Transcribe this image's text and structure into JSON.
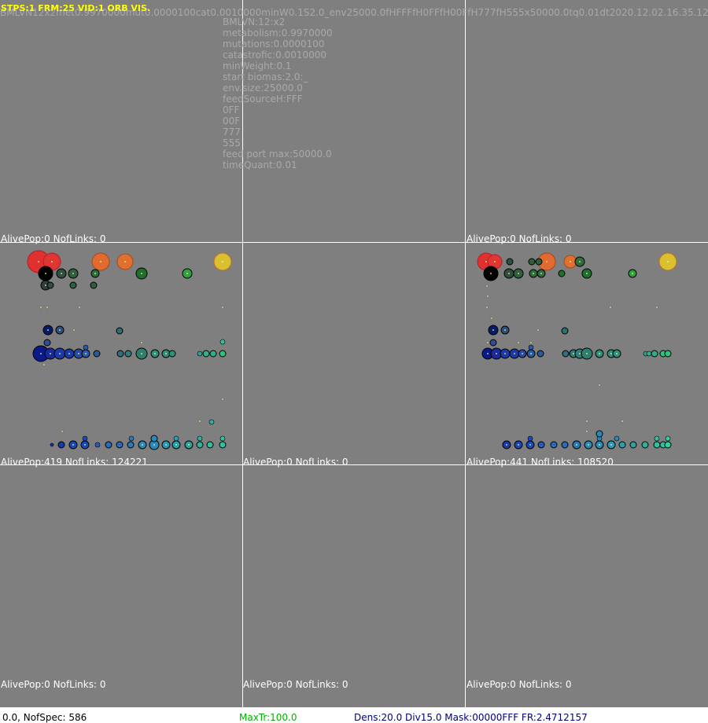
{
  "hud": "STPS:1 FRM:25 VID:1 ORB VIS.",
  "header_line": "BMLVN12x2met0.9970000mut0.0000100cat0.0010000minW0.1S2.0_env25000.0fHFFFfH0FFfH00FfH777fH555x50000.0tq0.01dt2020.12.02.16.35.12",
  "params": [
    "BMLVN:12:x2",
    "metabolism:0.9970000",
    "mutations:0.0000100",
    "catastrofic:0.0010000",
    "minWeight:0.1",
    "start biomas:2.0:_",
    "env.size:25000.0",
    "feedSourceH:FFF",
    "0FF",
    "00F",
    "777",
    "555",
    "feed port max:50000.0",
    "timeQuant:0.01"
  ],
  "panel_stats": {
    "top_left": "AlivePop:0 NofLinks: 0",
    "top_right": "AlivePop:0 NofLinks: 0",
    "mid_left": "AlivePop:419 NofLinks: 124221",
    "mid_center": "AlivePop:0 NofLinks: 0",
    "mid_right": "AlivePop:441 NofLinks: 108520",
    "bot_left": "AlivePop:0 NofLinks: 0",
    "bot_center": "AlivePop:0 NofLinks: 0",
    "bot_right": "AlivePop:0 NofLinks: 0"
  },
  "bottom_bar": {
    "time_spec": "0.0, NofSpec: 586",
    "maxtr": "MaxTr:100.0",
    "dens": "Dens:20.0 Div15.0 Mask:00000FFF FR:2.4712157"
  },
  "colors": {
    "background": "#7f7f7f",
    "grid": "#ffffff",
    "hud": "#ffff00",
    "header": "#a9a9a9",
    "maxtr": "#00b000",
    "dens": "#000080"
  }
}
